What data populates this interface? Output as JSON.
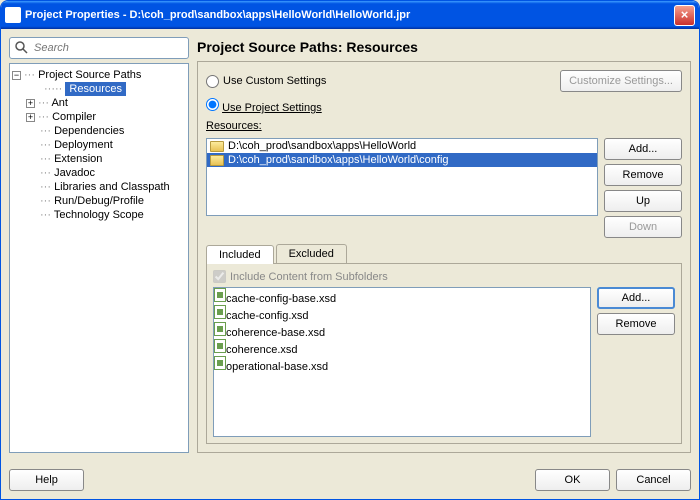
{
  "window": {
    "title": "Project Properties - D:\\coh_prod\\sandbox\\apps\\HelloWorld\\HelloWorld.jpr"
  },
  "search": {
    "placeholder": "Search"
  },
  "tree": {
    "root": "Project Source Paths",
    "root_child": "Resources",
    "items": [
      "Ant",
      "Compiler",
      "Dependencies",
      "Deployment",
      "Extension",
      "Javadoc",
      "Libraries and Classpath",
      "Run/Debug/Profile",
      "Technology Scope"
    ]
  },
  "main": {
    "title": "Project Source Paths: Resources",
    "radio_custom": "Use Custom Settings",
    "radio_project": "Use Project Settings",
    "customize_btn": "Customize Settings...",
    "resources_label": "Resources:",
    "resources": [
      {
        "path": "D:\\coh_prod\\sandbox\\apps\\HelloWorld",
        "selected": false
      },
      {
        "path": "D:\\coh_prod\\sandbox\\apps\\HelloWorld\\config",
        "selected": true
      }
    ],
    "btns": {
      "add": "Add...",
      "remove": "Remove",
      "up": "Up",
      "down": "Down"
    },
    "tabs": {
      "included": "Included",
      "excluded": "Excluded"
    },
    "include_subfolders": "Include Content from Subfolders",
    "files": [
      {
        "name": "cache-config-base.xsd",
        "selected": false
      },
      {
        "name": "cache-config.xsd",
        "selected": false
      },
      {
        "name": "coherence-base.xsd",
        "selected": false
      },
      {
        "name": "coherence.xsd",
        "selected": false
      },
      {
        "name": "operational-base.xsd",
        "selected": true
      }
    ],
    "inc_btns": {
      "add": "Add...",
      "remove": "Remove"
    }
  },
  "footer": {
    "help": "Help",
    "ok": "OK",
    "cancel": "Cancel"
  }
}
